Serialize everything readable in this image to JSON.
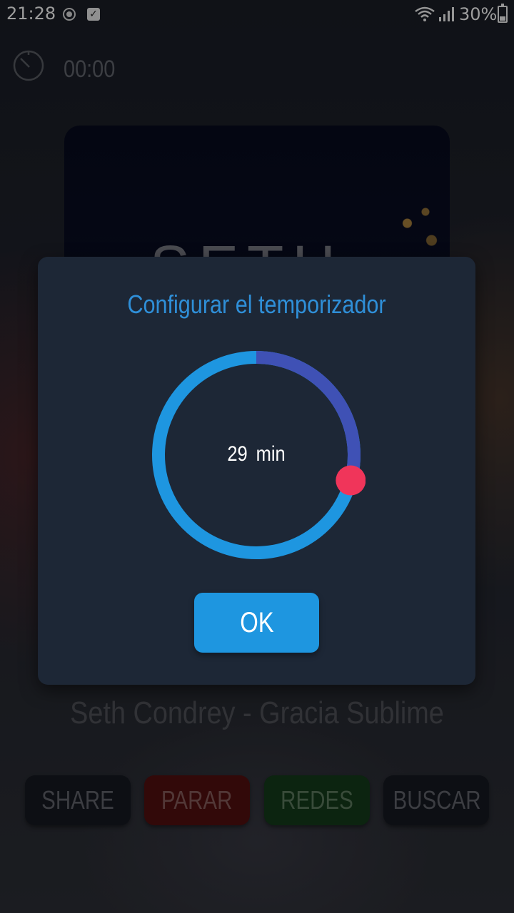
{
  "status_bar": {
    "time": "21:28",
    "battery": "30%",
    "battery_level": 0.3
  },
  "player": {
    "timer": "00:00",
    "album_art_text": "SETH",
    "song_title": "Seth Condrey - Gracia Sublime",
    "actions": {
      "share": "SHARE",
      "stop": "PARAR",
      "social": "REDES",
      "search": "BUSCAR"
    }
  },
  "dialog": {
    "title": "Configurar el temporizador",
    "value": "29",
    "unit": "min",
    "ok": "OK",
    "fraction": 0.2917
  },
  "colors": {
    "dialog_bg": "#1d2736",
    "accent": "#1e96e0",
    "progress": "#3f51b5",
    "thumb": "#f0355a",
    "title": "#2f8fd8"
  }
}
